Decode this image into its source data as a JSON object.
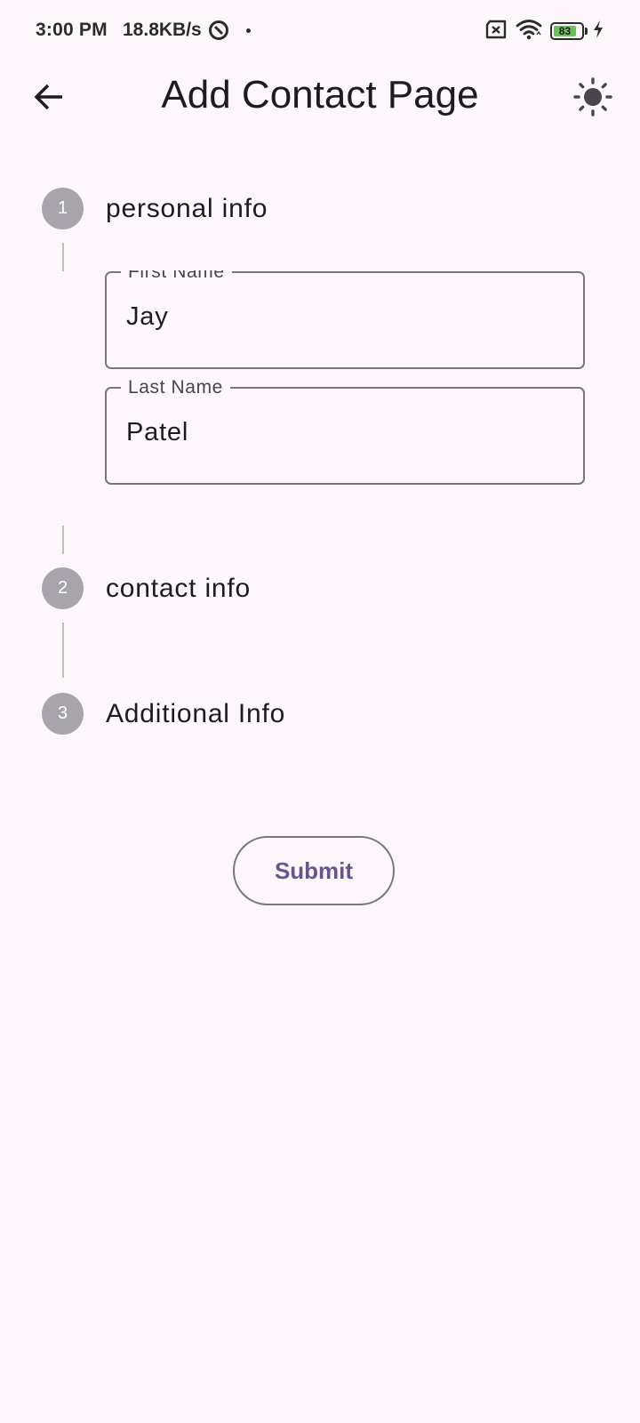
{
  "status_bar": {
    "time": "3:00 PM",
    "speed": "18.8KB/s",
    "battery_level": "83",
    "battery_fraction": 0.83
  },
  "app_bar": {
    "title": "Add Contact Page",
    "back_icon": "arrow-left-icon",
    "theme_icon": "sun-icon"
  },
  "stepper": {
    "steps": [
      {
        "number": "1",
        "title": "personal info"
      },
      {
        "number": "2",
        "title": "contact info"
      },
      {
        "number": "3",
        "title": "Additional Info"
      }
    ]
  },
  "personal_info": {
    "first_name": {
      "label": "First Name",
      "value": "Jay"
    },
    "last_name": {
      "label": "Last Name",
      "value": "Patel"
    }
  },
  "submit_label": "Submit",
  "colors": {
    "background": "#fdf7fc",
    "step_circle": "#a8a4ab",
    "accent": "#65558f",
    "outline": "#79747e"
  }
}
